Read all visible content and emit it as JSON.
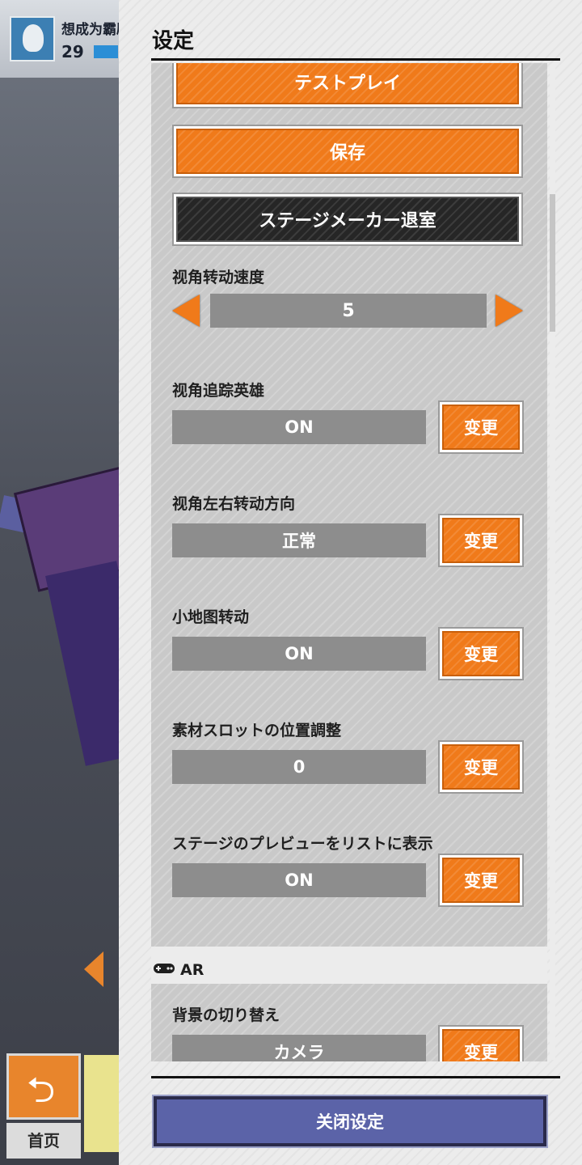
{
  "background": {
    "player_name": "想成为霸剧的像",
    "player_level": "29",
    "home_label": "首页"
  },
  "panel": {
    "title": "设定",
    "buttons": {
      "test_play": "テストプレイ",
      "save": "保存",
      "exit_stage_maker": "ステージメーカー退室"
    },
    "camera_speed": {
      "label": "视角转动速度",
      "value": "5"
    },
    "settings": [
      {
        "label": "视角追踪英雄",
        "value": "ON",
        "button": "变更"
      },
      {
        "label": "视角左右转动方向",
        "value": "正常",
        "button": "变更"
      },
      {
        "label": "小地图转动",
        "value": "ON",
        "button": "变更"
      },
      {
        "label": "素材スロットの位置調整",
        "value": "0",
        "button": "变更"
      },
      {
        "label": "ステージのプレビューをリストに表示",
        "value": "ON",
        "button": "变更"
      }
    ],
    "ar_section": {
      "title": "AR",
      "icon": "gamepad-icon",
      "label": "背景の切り替え",
      "value": "カメラ",
      "button": "变更"
    },
    "close_button": "关闭设定"
  },
  "colors": {
    "accent_orange": "#f07a1a",
    "dark_button": "#262626",
    "close_button": "#5b63a8",
    "value_box": "#8d8d8d"
  }
}
